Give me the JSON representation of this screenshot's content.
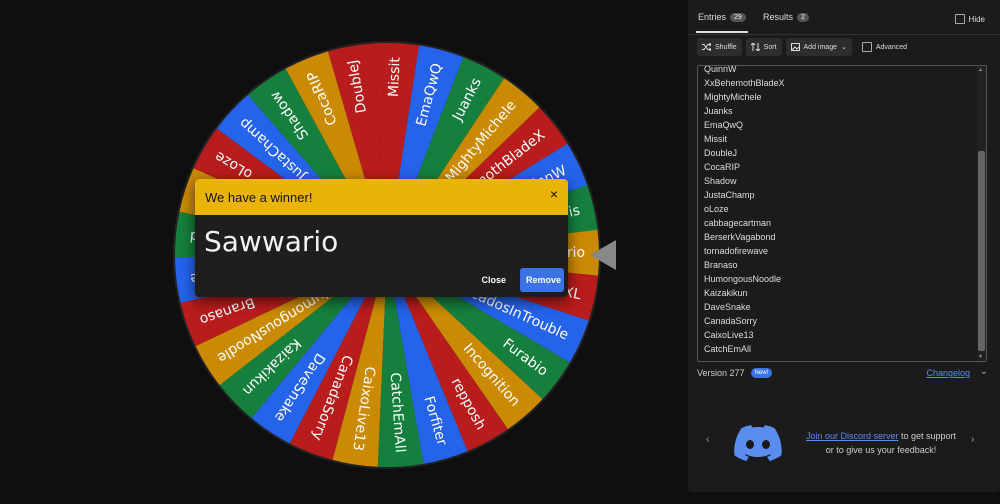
{
  "wheel": {
    "segments": [
      "Missit",
      "EmaQwQ",
      "Juanks",
      "MightyMichele",
      "XxBehemothBladeX",
      "QuinnW",
      "Lewis",
      "Sawwario",
      "TwixXL",
      "AvocadosInTrouble",
      "Furabio",
      "Incognition",
      "repposh",
      "Forfiter",
      "CatchEmAll",
      "CaixoLive13",
      "CanadaSorry",
      "DaveSnake",
      "Kaizakikun",
      "HumongousNoodle",
      "Branaso",
      "tornadofirewave",
      "BerserkVagabond",
      "cabbagecartman",
      "oLoze",
      "JustaChamp",
      "Shadow",
      "CocaRIP",
      "DoubleJ"
    ],
    "colors": [
      "#b91c1c",
      "#2563eb",
      "#15803d",
      "#ca8a04"
    ]
  },
  "modal": {
    "header": "We have a winner!",
    "close_x": "×",
    "winner": "Sawwario",
    "close_label": "Close",
    "remove_label": "Remove"
  },
  "panel": {
    "tabs": [
      {
        "label": "Entries",
        "count": "29"
      },
      {
        "label": "Results",
        "count": "2"
      }
    ],
    "hide_label": "Hide",
    "toolbar": {
      "shuffle": "Shuffle",
      "sort": "Sort",
      "add_image": "Add image",
      "advanced": "Advanced"
    },
    "entries": [
      "QuinnW",
      "XxBehemothBladeX",
      "MightyMichele",
      "Juanks",
      "EmaQwQ",
      "Missit",
      "DoubleJ",
      "CocaRIP",
      "Shadow",
      "JustaChamp",
      "oLoze",
      "cabbagecartman",
      "BerserkVagabond",
      "tornadofirewave",
      "Branaso",
      "HumongousNoodle",
      "Kaizakikun",
      "DaveSnake",
      "CanadaSorry",
      "CaixoLive13",
      "CatchEmAll"
    ],
    "version": "Version 277",
    "new_badge": "New!",
    "changelog": "Changelog",
    "discord": {
      "link": "Join our Discord server",
      "text1": " to get support",
      "text2": "or to give us your feedback!"
    },
    "icons": {
      "prev": "‹",
      "next": "›",
      "chevron": "⌄"
    }
  }
}
